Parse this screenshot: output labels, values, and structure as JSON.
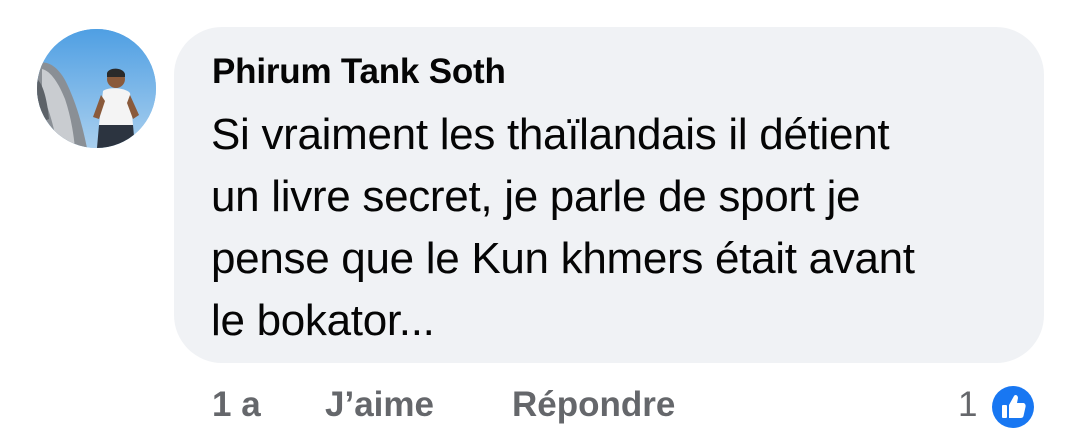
{
  "comment": {
    "author": "Phirum Tank Soth",
    "text_lines": [
      "Si vraiment les thaïlandais il détient",
      "un livre secret, je parle de sport je",
      "pense que le Kun khmers était avant",
      "le bokator..."
    ],
    "time": "1 a",
    "like_label": "J’aime",
    "reply_label": "Répondre",
    "reaction_count": "1",
    "reaction_icon": "thumbs-up-icon"
  },
  "colors": {
    "bubble": "#f0f2f5",
    "text": "#050505",
    "secondary": "#65676b",
    "reaction_blue": "#1877f2"
  }
}
